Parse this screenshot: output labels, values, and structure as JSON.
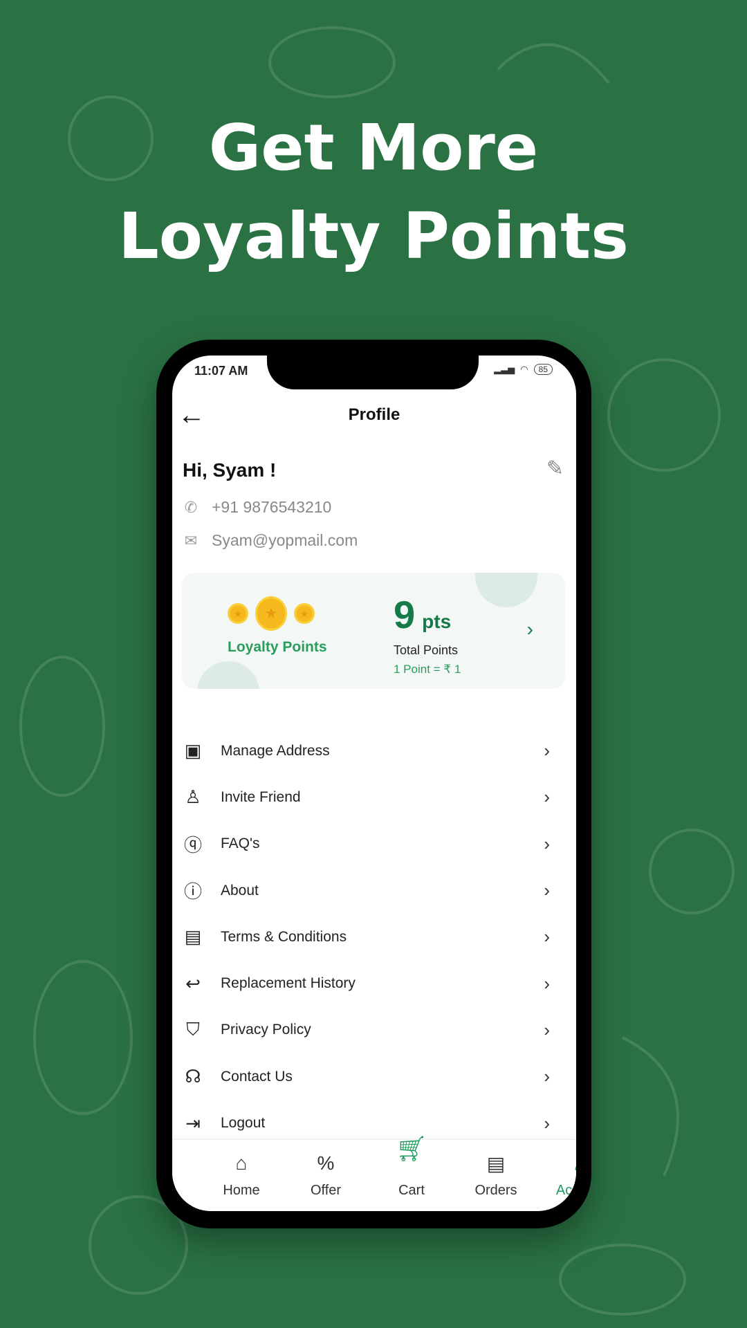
{
  "headline": {
    "line1": "Get More",
    "line2": "Loyalty Points"
  },
  "status_bar": {
    "time": "11:07 AM",
    "battery": "85"
  },
  "header": {
    "title": "Profile"
  },
  "profile": {
    "greeting": "Hi, Syam !",
    "phone": "+91 9876543210",
    "email": "Syam@yopmail.com"
  },
  "loyalty": {
    "label": "Loyalty Points",
    "points": "9",
    "unit": "pts",
    "total_label": "Total Points",
    "rate": "1 Point = ₹ 1"
  },
  "menu": [
    {
      "label": "Manage Address",
      "icon": "address-book-icon"
    },
    {
      "label": "Invite Friend",
      "icon": "add-user-icon"
    },
    {
      "label": "FAQ's",
      "icon": "question-icon"
    },
    {
      "label": "About",
      "icon": "info-icon"
    },
    {
      "label": "Terms & Conditions",
      "icon": "document-check-icon"
    },
    {
      "label": "Replacement History",
      "icon": "undo-icon"
    },
    {
      "label": "Privacy Policy",
      "icon": "shield-icon"
    },
    {
      "label": "Contact Us",
      "icon": "headset-icon"
    },
    {
      "label": "Logout",
      "icon": "logout-icon"
    }
  ],
  "nav": [
    {
      "label": "Home"
    },
    {
      "label": "Offer"
    },
    {
      "label": "Cart"
    },
    {
      "label": "Orders"
    },
    {
      "label": "Account"
    }
  ],
  "colors": {
    "background": "#2a7244",
    "accent": "#1e9a5e",
    "coin": "#f5b91e"
  }
}
